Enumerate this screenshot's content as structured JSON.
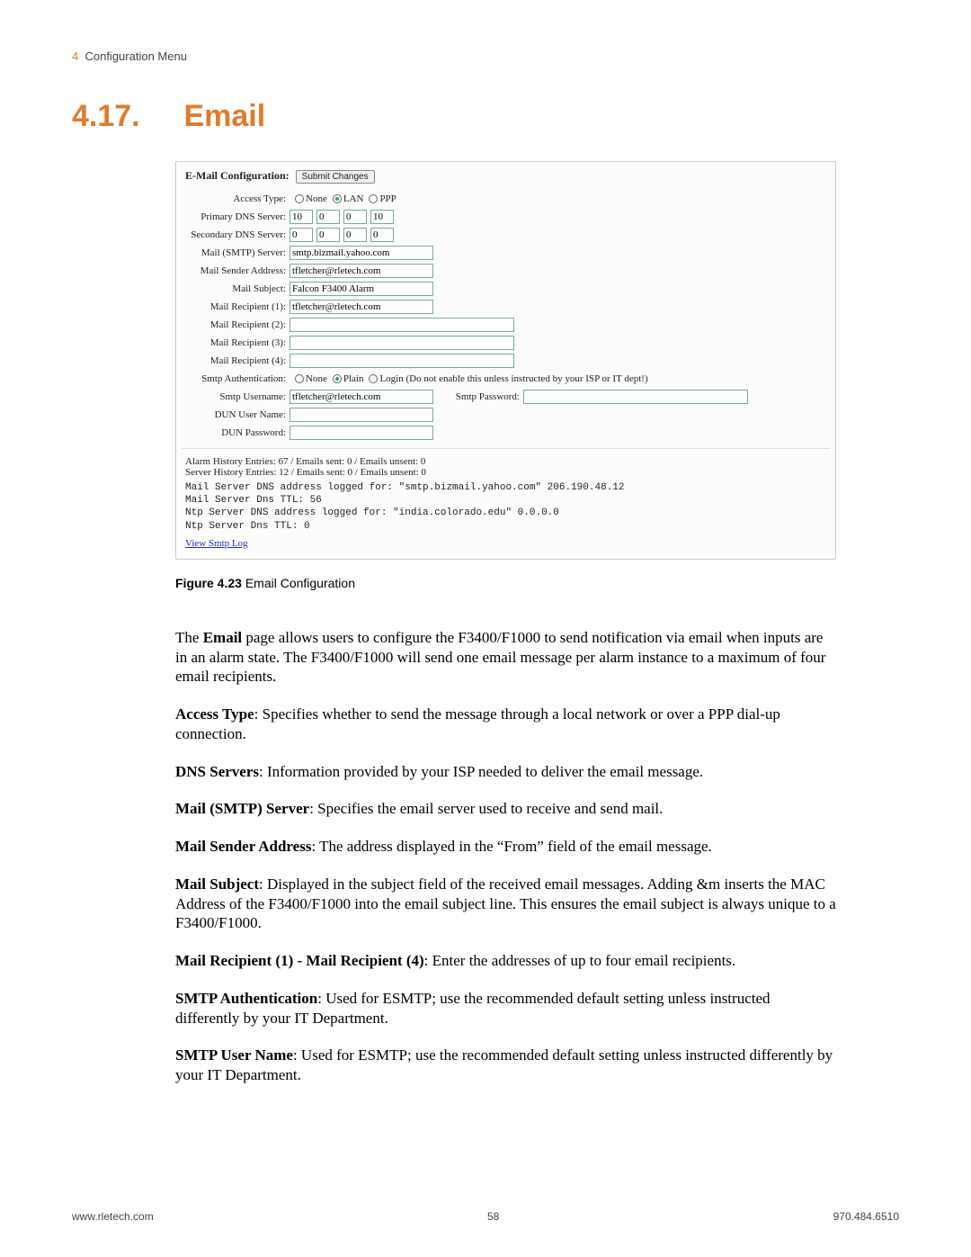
{
  "header": {
    "chapter_num": "4",
    "chapter_title": "Configuration Menu"
  },
  "section": {
    "number": "4.17.",
    "title": "Email"
  },
  "panel": {
    "title": "E-Mail Configuration:",
    "submit_label": "Submit Changes",
    "labels": {
      "access_type": "Access Type:",
      "primary_dns": "Primary DNS Server:",
      "secondary_dns": "Secondary DNS Server:",
      "smtp_server": "Mail (SMTP) Server:",
      "sender": "Mail Sender Address:",
      "subject": "Mail Subject:",
      "rcpt1": "Mail Recipient (1):",
      "rcpt2": "Mail Recipient (2):",
      "rcpt3": "Mail Recipient (3):",
      "rcpt4": "Mail Recipient (4):",
      "smtp_auth": "Smtp Authentication:",
      "smtp_user": "Smtp Username:",
      "smtp_pass": "Smtp Password:",
      "dun_user": "DUN User Name:",
      "dun_pass": "DUN Password:"
    },
    "access_options": {
      "none": "None",
      "lan": "LAN",
      "ppp": "PPP"
    },
    "auth_options": {
      "none": "None",
      "plain": "Plain",
      "login": "Login"
    },
    "auth_note": "(Do not enable this unless instructed by your ISP or IT dept!)",
    "values": {
      "primary_dns": [
        "10",
        "0",
        "0",
        "10"
      ],
      "secondary_dns": [
        "0",
        "0",
        "0",
        "0"
      ],
      "smtp_server": "smtp.bizmail.yahoo.com",
      "sender": "tfletcher@rletech.com",
      "subject": "Falcon F3400 Alarm",
      "rcpt1": "tfletcher@rletech.com",
      "rcpt2": "",
      "rcpt3": "",
      "rcpt4": "",
      "smtp_user": "tfletcher@rletech.com",
      "smtp_pass": "",
      "dun_user": "",
      "dun_pass": ""
    },
    "status1": "Alarm History Entries: 67  /  Emails sent: 0  /  Emails unsent: 0",
    "status2": "Server History Entries: 12  /  Emails sent: 0  /  Emails unsent: 0",
    "log_lines": "Mail Server DNS address logged for: \"smtp.bizmail.yahoo.com\" 206.190.48.12\nMail Server Dns TTL: 56\nNtp Server DNS address logged for: \"india.colorado.edu\" 0.0.0.0\nNtp Server Dns TTL: 0",
    "link": "View Smtp Log"
  },
  "figure": {
    "label": "Figure 4.23",
    "caption": "Email Configuration"
  },
  "paragraphs": {
    "p1_a": "The ",
    "p1_b": "Email",
    "p1_c": " page allows users to configure the F3400/F1000 to send notification via email when inputs are in an alarm state. The F3400/F1000 will send one email message per alarm instance to a maximum of four email recipients.",
    "p2_a": "Access Type",
    "p2_b": ": Specifies whether to send the message through a local network or over a PPP dial-up connection.",
    "p3_a": "DNS Servers",
    "p3_b": ": Information provided by your ISP needed to deliver the email message.",
    "p4_a": "Mail (SMTP) Server",
    "p4_b": ": Specifies the email server used to receive and send mail.",
    "p5_a": "Mail Sender Address",
    "p5_b": ": The address displayed in the “From” field of the email message.",
    "p6_a": "Mail Subject",
    "p6_b": ": Displayed in the subject field of the received email messages. Adding &m inserts the MAC Address of the F3400/F1000 into the email subject line. This ensures the email subject is always unique to a F3400/F1000.",
    "p7_a": "Mail Recipient (1) - Mail Recipient (4)",
    "p7_b": ": Enter the addresses of up to four email recipients.",
    "p8_a": "SMTP Authentication",
    "p8_b": ": Used for ESMTP; use the recommended default setting unless instructed differently by your IT Department.",
    "p9_a": "SMTP User Name",
    "p9_b": ": Used for ESMTP; use the recommended default setting unless instructed differently by your IT Department."
  },
  "footer": {
    "left": "www.rletech.com",
    "center": "58",
    "right": "970.484.6510"
  }
}
